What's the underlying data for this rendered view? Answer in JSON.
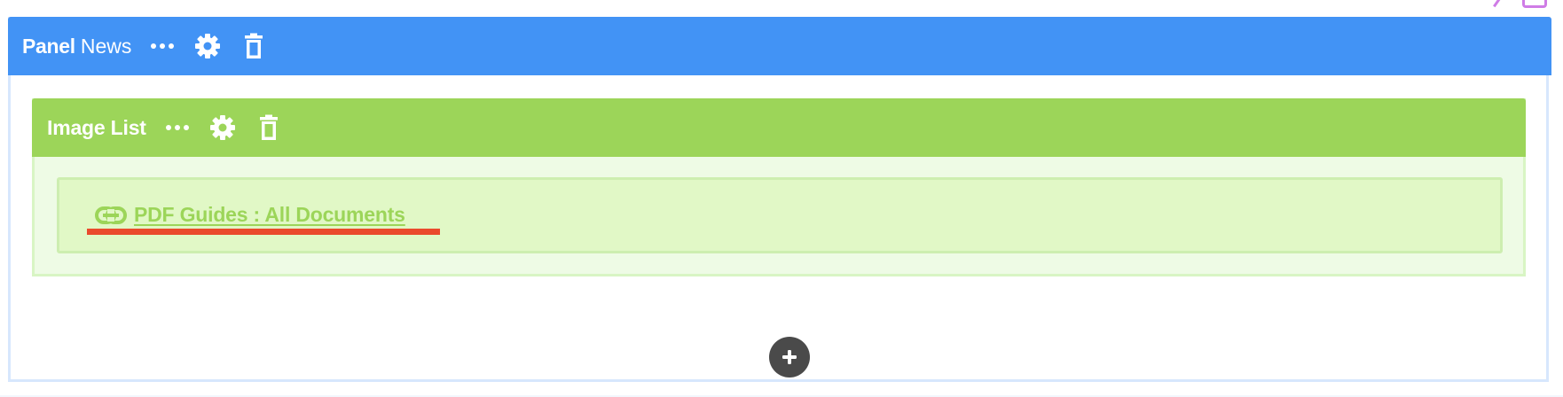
{
  "panel": {
    "title_strong": "Panel",
    "title_light": "News",
    "icons": {
      "more": "more-dots-icon",
      "settings": "gear-icon",
      "delete": "trash-icon"
    },
    "header_color": "#4293f5"
  },
  "block": {
    "title": "Image List",
    "icons": {
      "more": "more-dots-icon",
      "settings": "gear-icon",
      "delete": "trash-icon"
    },
    "header_color": "#9cd559",
    "items": [
      {
        "icon": "link-icon",
        "label": "PDF Guides : All Documents",
        "highlight_color": "#ea4a2c"
      }
    ]
  },
  "add_button": {
    "icon": "plus-icon",
    "color": "#4a4a4a"
  },
  "corner": {
    "icons": [
      "pin-icon",
      "copy-icon"
    ],
    "color": "#cf7ce6"
  }
}
